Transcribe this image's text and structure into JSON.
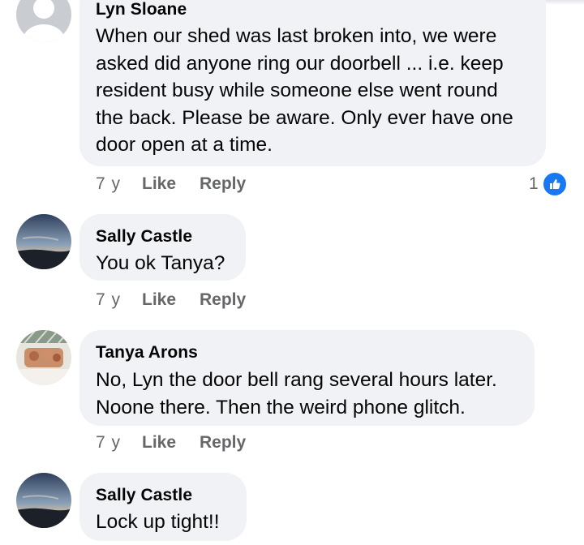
{
  "comments": [
    {
      "author": "Lyn Sloane",
      "lines": [
        "When our shed was last broken into, we were",
        "asked did anyone ring our doorbell ... i.e. keep",
        "resident busy while someone else went round",
        "the back. Please be aware. Only ever have one",
        "door open at a time."
      ],
      "time": "7 y",
      "like": "Like",
      "reply": "Reply",
      "reaction_count": "1",
      "reaction_icon": "thumbs-up-icon"
    },
    {
      "author": "Sally Castle",
      "lines": [
        "You ok Tanya?"
      ],
      "time": "7 y",
      "like": "Like",
      "reply": "Reply"
    },
    {
      "author": "Tanya Arons",
      "lines": [
        "No, Lyn the door bell rang several hours later.",
        "Noone there.  Then the weird phone glitch."
      ],
      "time": "7 y",
      "like": "Like",
      "reply": "Reply"
    },
    {
      "author": "Sally Castle",
      "lines": [
        "Lock up tight!!"
      ]
    }
  ],
  "colors": {
    "bubble": "#f0f2f5",
    "meta_text": "#65676b",
    "reaction_blue": "#1877f2"
  }
}
